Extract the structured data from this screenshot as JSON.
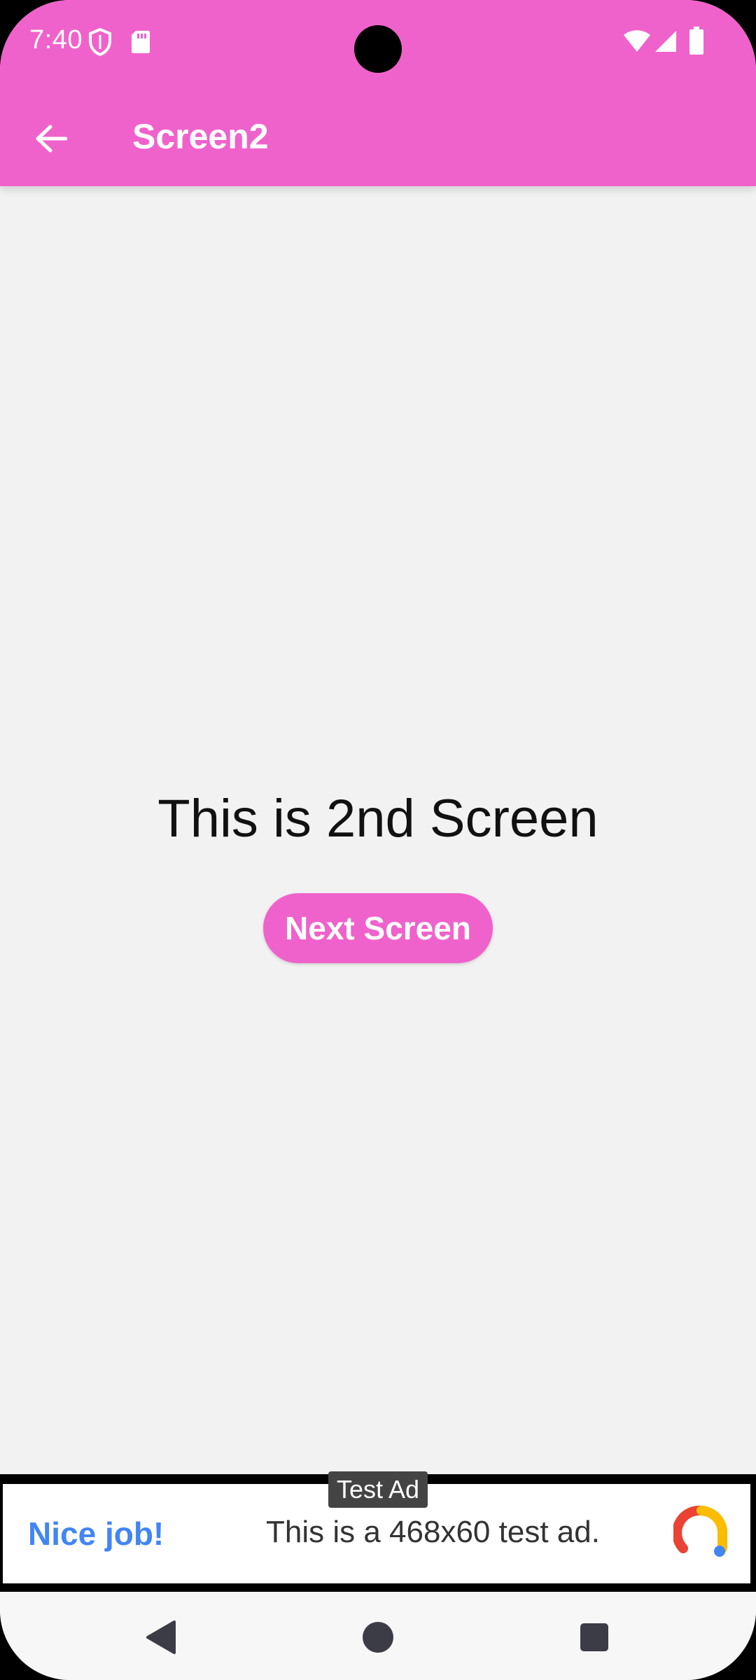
{
  "status_bar": {
    "time": "7:40",
    "icons": [
      "shield-icon",
      "sd-card-icon",
      "wifi-icon",
      "signal-icon",
      "battery-icon"
    ]
  },
  "app_bar": {
    "title": "Screen2",
    "back_icon": "arrow-back-icon",
    "color": "#f062cb"
  },
  "main": {
    "text": "This is 2nd Screen",
    "button_label": "Next Screen"
  },
  "ad": {
    "label": "Test Ad",
    "headline": "Nice job!",
    "body": "This is a 468x60 test ad.",
    "logo_icon": "admob-logo-icon"
  },
  "nav_bar": {
    "buttons": [
      "back-triangle-icon",
      "home-circle-icon",
      "recents-square-icon"
    ]
  }
}
